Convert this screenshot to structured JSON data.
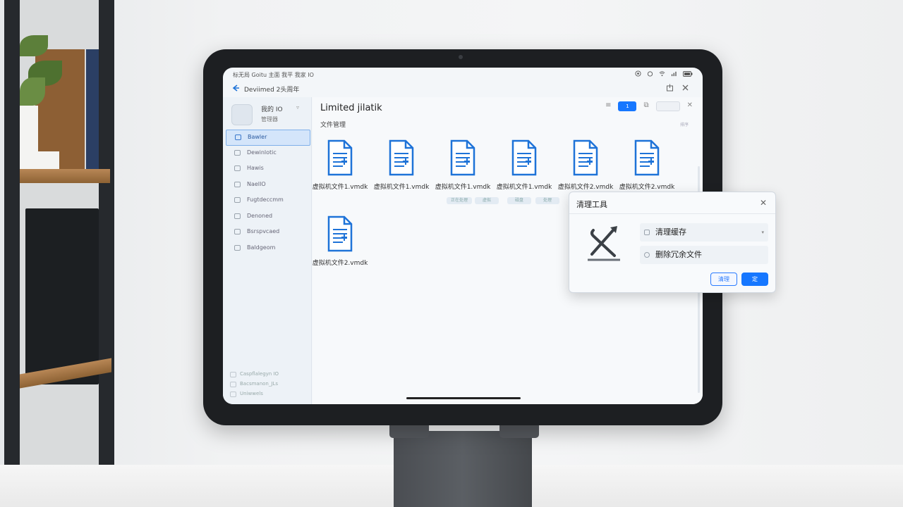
{
  "statusbar": {
    "left_text": "标无局  Goitu 主面  我平 我家 IO"
  },
  "titlebar": {
    "title": "Deviimed 2头周年"
  },
  "sidebar": {
    "profile_name": "我的 IO",
    "profile_sub": "管理器",
    "items": [
      {
        "label": "Bawler"
      },
      {
        "label": "Dewinlotic"
      },
      {
        "label": "Hawis"
      },
      {
        "label": "NaelIO"
      },
      {
        "label": "Fugtdeccmm"
      },
      {
        "label": "Denoned"
      },
      {
        "label": "Bsrspvcaed"
      },
      {
        "label": "Baldgeom"
      }
    ],
    "footer": [
      "Caspflalegyn IO",
      "Bacsmanon_JLs",
      "Uniwwels"
    ]
  },
  "main": {
    "heading": "Limited jilatik",
    "section": "文件管理",
    "hint": "排序",
    "toolbar": {
      "list_icon": "list-icon",
      "primary_label": "1",
      "copy_label": "⧉",
      "empty_btn": "",
      "close_label": "✕"
    },
    "files": [
      {
        "name": "虚拟机文件1.vmdk"
      },
      {
        "name": "虚拟机文件1.vmdk"
      },
      {
        "name": "虚拟机文件1.vmdk"
      },
      {
        "name": "虚拟机文件1.vmdk"
      },
      {
        "name": "虚拟机文件2.vmdk"
      },
      {
        "name": "虚拟机文件2.vmdk"
      },
      {
        "name": "虚拟机文件2.vmdk"
      }
    ],
    "chips": [
      "正在处理",
      "虚拟",
      "磁盘",
      "处理"
    ]
  },
  "dialog": {
    "title": "清理工具",
    "options": [
      {
        "label": "清理缓存"
      },
      {
        "label": "删除冗余文件"
      }
    ],
    "secondary_button": "清理",
    "primary_button": "定",
    "tool_icon": "cleanup-tools-icon"
  },
  "colors": {
    "accent": "#1677ff",
    "icon_blue": "#1e73d8",
    "sidebar_active": "#d4e5fa"
  }
}
